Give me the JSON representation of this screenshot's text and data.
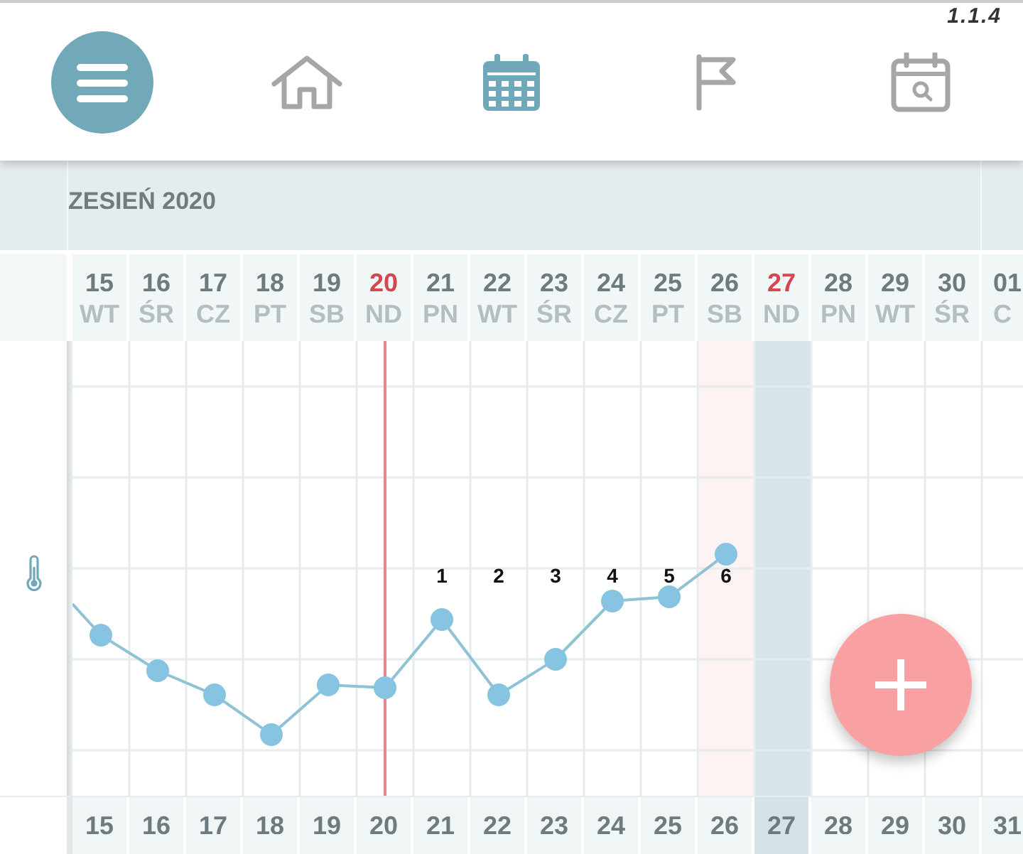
{
  "app_version": "1.1.4",
  "nav_tabs": [
    {
      "selected": false
    },
    {
      "selected": true
    },
    {
      "selected": false
    },
    {
      "selected": false
    }
  ],
  "month_label": "ZESIEŃ 2020",
  "days": [
    {
      "day": "15",
      "weekday": "WT",
      "sunday": false,
      "line_marker": false,
      "tinted": false,
      "highlighted": false
    },
    {
      "day": "16",
      "weekday": "ŚR",
      "sunday": false,
      "line_marker": false,
      "tinted": false,
      "highlighted": false
    },
    {
      "day": "17",
      "weekday": "CZ",
      "sunday": false,
      "line_marker": false,
      "tinted": false,
      "highlighted": false
    },
    {
      "day": "18",
      "weekday": "PT",
      "sunday": false,
      "line_marker": false,
      "tinted": false,
      "highlighted": false
    },
    {
      "day": "19",
      "weekday": "SB",
      "sunday": false,
      "line_marker": false,
      "tinted": false,
      "highlighted": false
    },
    {
      "day": "20",
      "weekday": "ND",
      "sunday": true,
      "line_marker": true,
      "tinted": false,
      "highlighted": false
    },
    {
      "day": "21",
      "weekday": "PN",
      "sunday": false,
      "line_marker": false,
      "tinted": false,
      "highlighted": false,
      "cycle_day": "1"
    },
    {
      "day": "22",
      "weekday": "WT",
      "sunday": false,
      "line_marker": false,
      "tinted": false,
      "highlighted": false,
      "cycle_day": "2"
    },
    {
      "day": "23",
      "weekday": "ŚR",
      "sunday": false,
      "line_marker": false,
      "tinted": false,
      "highlighted": false,
      "cycle_day": "3"
    },
    {
      "day": "24",
      "weekday": "CZ",
      "sunday": false,
      "line_marker": false,
      "tinted": false,
      "highlighted": false,
      "cycle_day": "4"
    },
    {
      "day": "25",
      "weekday": "PT",
      "sunday": false,
      "line_marker": false,
      "tinted": false,
      "highlighted": false,
      "cycle_day": "5"
    },
    {
      "day": "26",
      "weekday": "SB",
      "sunday": false,
      "line_marker": false,
      "tinted": true,
      "highlighted": false,
      "cycle_day": "6"
    },
    {
      "day": "27",
      "weekday": "ND",
      "sunday": true,
      "line_marker": false,
      "tinted": false,
      "highlighted": true
    },
    {
      "day": "28",
      "weekday": "PN",
      "sunday": false,
      "line_marker": false,
      "tinted": false,
      "highlighted": false
    },
    {
      "day": "29",
      "weekday": "WT",
      "sunday": false,
      "line_marker": false,
      "tinted": false,
      "highlighted": false
    },
    {
      "day": "30",
      "weekday": "ŚR",
      "sunday": false,
      "line_marker": false,
      "tinted": false,
      "highlighted": false
    },
    {
      "day": "01",
      "weekday": "C",
      "sunday": false,
      "line_marker": false,
      "tinted": false,
      "highlighted": false
    }
  ],
  "footer_days": [
    {
      "label": "15",
      "highlighted": false
    },
    {
      "label": "16",
      "highlighted": false
    },
    {
      "label": "17",
      "highlighted": false
    },
    {
      "label": "18",
      "highlighted": false
    },
    {
      "label": "19",
      "highlighted": false
    },
    {
      "label": "20",
      "highlighted": false
    },
    {
      "label": "21",
      "highlighted": false
    },
    {
      "label": "22",
      "highlighted": false
    },
    {
      "label": "23",
      "highlighted": false
    },
    {
      "label": "24",
      "highlighted": false
    },
    {
      "label": "25",
      "highlighted": false
    },
    {
      "label": "26",
      "highlighted": false
    },
    {
      "label": "27",
      "highlighted": true
    },
    {
      "label": "28",
      "highlighted": false
    },
    {
      "label": "29",
      "highlighted": false
    },
    {
      "label": "30",
      "highlighted": false
    },
    {
      "label": "31",
      "highlighted": false
    }
  ]
}
